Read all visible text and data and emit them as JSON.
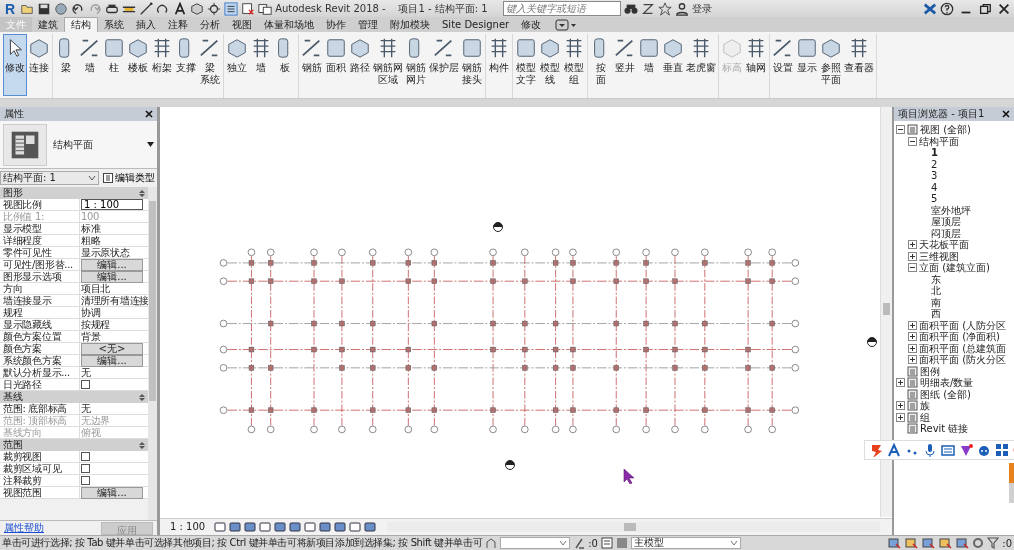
{
  "window": {
    "logo": "R",
    "title": "Autodesk Revit 2018 -    项目1 - 结构平面: 1",
    "search": {
      "placeholder": "键入关键字或短语"
    },
    "login": "登录"
  },
  "tabs": [
    {
      "label": "文件",
      "selected": false,
      "kind": "file"
    },
    {
      "label": "建筑",
      "selected": false,
      "kind": "tab"
    },
    {
      "label": "结构",
      "selected": true,
      "kind": "tab"
    },
    {
      "label": "系统",
      "selected": false,
      "kind": "tab"
    },
    {
      "label": "插入",
      "selected": false,
      "kind": "tab"
    },
    {
      "label": "注释",
      "selected": false,
      "kind": "tab"
    },
    {
      "label": "分析",
      "selected": false,
      "kind": "tab"
    },
    {
      "label": "视图",
      "selected": false,
      "kind": "tab"
    },
    {
      "label": "体量和场地",
      "selected": false,
      "kind": "tab"
    },
    {
      "label": "协作",
      "selected": false,
      "kind": "tab"
    },
    {
      "label": "管理",
      "selected": false,
      "kind": "tab"
    },
    {
      "label": "附加模块",
      "selected": false,
      "kind": "tab"
    },
    {
      "label": "Site Designer",
      "selected": false,
      "kind": "tab"
    },
    {
      "label": "修改",
      "selected": false,
      "kind": "tab"
    }
  ],
  "ribbon": {
    "groups": [
      {
        "tools": [
          {
            "label": "修改",
            "selected": true,
            "disabled": false
          },
          {
            "label": "连接",
            "selected": false,
            "disabled": false
          }
        ]
      },
      {
        "tools": [
          {
            "label": "梁",
            "selected": false,
            "disabled": false
          },
          {
            "label": "墙",
            "selected": false,
            "disabled": false
          },
          {
            "label": "柱",
            "selected": false,
            "disabled": false
          },
          {
            "label": "楼板",
            "selected": false,
            "disabled": false
          },
          {
            "label": "桁架",
            "selected": false,
            "disabled": false
          },
          {
            "label": "支撑",
            "selected": false,
            "disabled": false
          },
          {
            "label": "梁系统",
            "kind": "stacked_single",
            "selected": false,
            "disabled": false
          }
        ]
      },
      {
        "tools": [
          {
            "label": "独立",
            "selected": false,
            "disabled": false
          },
          {
            "label": "墙",
            "selected": false,
            "disabled": false
          },
          {
            "label": "板",
            "selected": false,
            "disabled": false
          }
        ]
      },
      {
        "tools": [
          {
            "label": "钢筋",
            "selected": false,
            "disabled": false
          },
          {
            "label": "面积",
            "selected": false,
            "disabled": false
          },
          {
            "label": "路径",
            "selected": false,
            "disabled": false
          },
          {
            "label": "钢筋网区域",
            "kind": "stacked",
            "selected": false,
            "disabled": false
          },
          {
            "label": "钢筋网片",
            "kind": "stacked",
            "selected": false,
            "disabled": false
          },
          {
            "label": "保护层",
            "selected": false,
            "disabled": false
          },
          {
            "label": "钢筋接头",
            "kind": "stacked",
            "selected": false,
            "disabled": false
          }
        ]
      },
      {
        "tools": [
          {
            "label": "构件",
            "selected": false,
            "disabled": false
          }
        ]
      },
      {
        "tools": [
          {
            "label": "模型文字",
            "kind": "stacked",
            "selected": false,
            "disabled": false
          },
          {
            "label": "模型线",
            "kind": "stacked",
            "selected": false,
            "disabled": false
          },
          {
            "label": "模型组",
            "kind": "stacked",
            "selected": false,
            "disabled": false
          }
        ]
      },
      {
        "tools": [
          {
            "label": "按面",
            "kind": "stacked",
            "selected": false,
            "disabled": false
          },
          {
            "label": "竖井",
            "selected": false,
            "disabled": false
          },
          {
            "label": "墙",
            "selected": false,
            "disabled": false
          },
          {
            "label": "垂直",
            "selected": false,
            "disabled": false
          },
          {
            "label": "老虎窗",
            "selected": false,
            "disabled": false
          }
        ]
      },
      {
        "tools": [
          {
            "label": "标高",
            "selected": false,
            "disabled": true
          },
          {
            "label": "轴网",
            "selected": false,
            "disabled": false
          }
        ]
      },
      {
        "tools": [
          {
            "label": "设置",
            "selected": false,
            "disabled": false
          },
          {
            "label": "显示",
            "selected": false,
            "disabled": false
          },
          {
            "label": "参照平面",
            "kind": "stacked",
            "selected": false,
            "disabled": false
          },
          {
            "label": "查看器",
            "selected": false,
            "disabled": false
          }
        ]
      }
    ]
  },
  "properties": {
    "title": "属性",
    "type_name": "结构平面",
    "selector": "结构平面: 1",
    "edit_type": "编辑类型",
    "sections": [
      {
        "title": "图形",
        "rows": [
          {
            "label": "视图比例",
            "value": "1 : 100",
            "kind": "input",
            "disabled": false
          },
          {
            "label": "比例值 1:",
            "value": "100",
            "kind": "text",
            "disabled": true
          },
          {
            "label": "显示模型",
            "value": "标准",
            "kind": "text",
            "disabled": false
          },
          {
            "label": "详细程度",
            "value": "粗略",
            "kind": "text",
            "disabled": false
          },
          {
            "label": "零件可见性",
            "value": "显示原状态",
            "kind": "text",
            "disabled": false
          },
          {
            "label": "可见性/图形替...",
            "value": "编辑...",
            "kind": "button",
            "disabled": false
          },
          {
            "label": "图形显示选项",
            "value": "编辑...",
            "kind": "button",
            "disabled": false
          },
          {
            "label": "方向",
            "value": "项目北",
            "kind": "text",
            "disabled": false
          },
          {
            "label": "墙连接显示",
            "value": "清理所有墙连接",
            "kind": "text",
            "disabled": false
          },
          {
            "label": "规程",
            "value": "协调",
            "kind": "text",
            "disabled": false
          },
          {
            "label": "显示隐藏线",
            "value": "按规程",
            "kind": "text",
            "disabled": false
          },
          {
            "label": "颜色方案位置",
            "value": "背景",
            "kind": "text",
            "disabled": false
          },
          {
            "label": "颜色方案",
            "value": "<无>",
            "kind": "button",
            "disabled": false
          },
          {
            "label": "系统颜色方案",
            "value": "编辑...",
            "kind": "button",
            "disabled": false
          },
          {
            "label": "默认分析显示...",
            "value": "无",
            "kind": "text",
            "disabled": false
          },
          {
            "label": "日光路径",
            "kind": "checkbox",
            "checked": false,
            "disabled": false
          }
        ]
      },
      {
        "title": "基线",
        "rows": [
          {
            "label": "范围: 底部标高",
            "value": "无",
            "kind": "text",
            "disabled": false
          },
          {
            "label": "范围: 顶部标高",
            "value": "无边界",
            "kind": "text",
            "disabled": true
          },
          {
            "label": "基线方向",
            "value": "俯视",
            "kind": "text",
            "disabled": true
          }
        ]
      },
      {
        "title": "范围",
        "rows": [
          {
            "label": "裁剪视图",
            "kind": "checkbox",
            "checked": false,
            "disabled": false
          },
          {
            "label": "裁剪区域可见",
            "kind": "checkbox",
            "checked": false,
            "disabled": false
          },
          {
            "label": "注释裁剪",
            "kind": "checkbox",
            "checked": false,
            "disabled": false
          },
          {
            "label": "视图范围",
            "value": "编辑...",
            "kind": "button",
            "disabled": false
          }
        ]
      }
    ],
    "help_link": "属性帮助",
    "apply_button": {
      "label": "应用",
      "disabled": true
    }
  },
  "view": {
    "scale": "1 : 100"
  },
  "browser": {
    "title": "项目浏览器 - 项目1",
    "tree": [
      {
        "label": "视图 (全部)",
        "expanded": true,
        "selected": false,
        "children": [
          {
            "label": "结构平面",
            "expanded": true,
            "selected": false,
            "children": [
              {
                "label": "1",
                "selected": true
              },
              {
                "label": "2",
                "selected": false
              },
              {
                "label": "3",
                "selected": false
              },
              {
                "label": "4",
                "selected": false
              },
              {
                "label": "5",
                "selected": false
              },
              {
                "label": "室外地坪",
                "selected": false
              },
              {
                "label": "屋顶层",
                "selected": false
              },
              {
                "label": "闷顶层",
                "selected": false
              }
            ]
          },
          {
            "label": "天花板平面",
            "expanded": false,
            "selected": false
          },
          {
            "label": "三维视图",
            "expanded": false,
            "selected": false
          },
          {
            "label": "立面 (建筑立面)",
            "expanded": true,
            "selected": false,
            "children": [
              {
                "label": "东",
                "selected": false
              },
              {
                "label": "北",
                "selected": false
              },
              {
                "label": "南",
                "selected": false
              },
              {
                "label": "西",
                "selected": false
              }
            ]
          },
          {
            "label": "面积平面 (人防分区",
            "expanded": false,
            "selected": false
          },
          {
            "label": "面积平面 (净面积)",
            "expanded": false,
            "selected": false
          },
          {
            "label": "面积平面 (总建筑面",
            "expanded": false,
            "selected": false
          },
          {
            "label": "面积平面 (防火分区",
            "expanded": false,
            "selected": false
          }
        ]
      },
      {
        "label": "图例",
        "selected": false
      },
      {
        "label": "明细表/数量",
        "expanded": false,
        "selected": false
      },
      {
        "label": "图纸 (全部)",
        "selected": false
      },
      {
        "label": "族",
        "expanded": false,
        "selected": false
      },
      {
        "label": "组",
        "expanded": false,
        "selected": false
      },
      {
        "label": "Revit 链接",
        "selected": false
      }
    ]
  },
  "status_bar": {
    "message": "单击可进行选择; 按 Tab 键并单击可选择其他项目; 按 Ctrl 键并单击可将新项目添加到选择集; 按 Shift 键并单击可",
    "selection_count": ":0",
    "model": "主模型",
    "filter_count": ":0"
  }
}
